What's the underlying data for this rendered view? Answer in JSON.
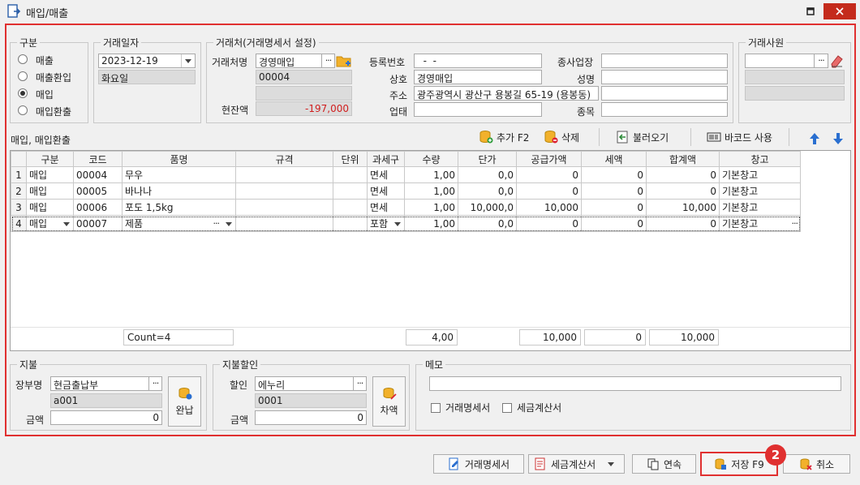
{
  "window": {
    "title": "매입/매출"
  },
  "gubun": {
    "title": "구분",
    "options": [
      "매출",
      "매출환입",
      "매입",
      "매입환출"
    ],
    "selected": 2
  },
  "date": {
    "title": "거래일자",
    "value": "2023-12-19",
    "weekday": "화요일"
  },
  "client": {
    "title": "거래처(거래명세서 설정)",
    "name_label": "거래처명",
    "name": "경영매입",
    "code": "00004",
    "balance_label": "현잔액",
    "balance": "-197,000",
    "reg_label": "등록번호",
    "reg": "  -  -",
    "company_label": "상호",
    "company": "경영매입",
    "address_label": "주소",
    "address": "광주광역시 광산구 용봉길 65-19 (용봉동)",
    "biz_type_label": "업태",
    "biz_type": "",
    "branch_label": "종사업장",
    "branch": "",
    "owner_label": "성명",
    "owner": "",
    "item_label": "종목",
    "item": ""
  },
  "staff": {
    "title": "거래사원",
    "value": ""
  },
  "toolbar": {
    "section_label": "매입, 매입환출",
    "add": "추가 F2",
    "delete": "삭제",
    "load": "불러오기",
    "barcode": "바코드 사용"
  },
  "grid": {
    "headers": [
      "구분",
      "코드",
      "품명",
      "규격",
      "단위",
      "과세구",
      "수량",
      "단가",
      "공급가액",
      "세액",
      "합계액",
      "창고"
    ],
    "rows": [
      {
        "no": "1",
        "type": "매입",
        "code": "00004",
        "name": "무우",
        "spec": "",
        "unit": "",
        "tax": "면세",
        "qty": "1,00",
        "price": "0,0",
        "supply": "0",
        "vat": "0",
        "total": "0",
        "wh": "기본창고"
      },
      {
        "no": "2",
        "type": "매입",
        "code": "00005",
        "name": "바나나",
        "spec": "",
        "unit": "",
        "tax": "면세",
        "qty": "1,00",
        "price": "0,0",
        "supply": "0",
        "vat": "0",
        "total": "0",
        "wh": "기본창고"
      },
      {
        "no": "3",
        "type": "매입",
        "code": "00006",
        "name": "포도 1,5kg",
        "spec": "",
        "unit": "",
        "tax": "면세",
        "qty": "1,00",
        "price": "10,000,0",
        "supply": "10,000",
        "vat": "0",
        "total": "10,000",
        "wh": "기본창고"
      },
      {
        "no": "4",
        "type": "매입",
        "code": "00007",
        "name": "제품",
        "spec": "",
        "unit": "",
        "tax": "포함",
        "qty": "1,00",
        "price": "0,0",
        "supply": "0",
        "vat": "0",
        "total": "0",
        "wh": "기본창고"
      }
    ],
    "footer": {
      "count": "Count=4",
      "qty": "4,00",
      "supply": "10,000",
      "vat": "0",
      "total": "10,000"
    }
  },
  "payment": {
    "title": "지불",
    "ledger_label": "장부명",
    "ledger": "현금출납부",
    "ledger_code": "a001",
    "amount_label": "금액",
    "amount": "0",
    "button": "완납"
  },
  "discount": {
    "title": "지불할인",
    "label": "할인",
    "value": "에누리",
    "code": "0001",
    "amount_label": "금액",
    "amount": "0",
    "button": "차액"
  },
  "memo": {
    "title": "메모",
    "value": "",
    "check1": "거래명세서",
    "check2": "세금계산서"
  },
  "bottom": {
    "statement": "거래명세서",
    "tax_invoice": "세금계산서",
    "continuous": "연속",
    "save": "저장 F9",
    "cancel": "취소"
  },
  "annotation": {
    "badge": "2"
  }
}
